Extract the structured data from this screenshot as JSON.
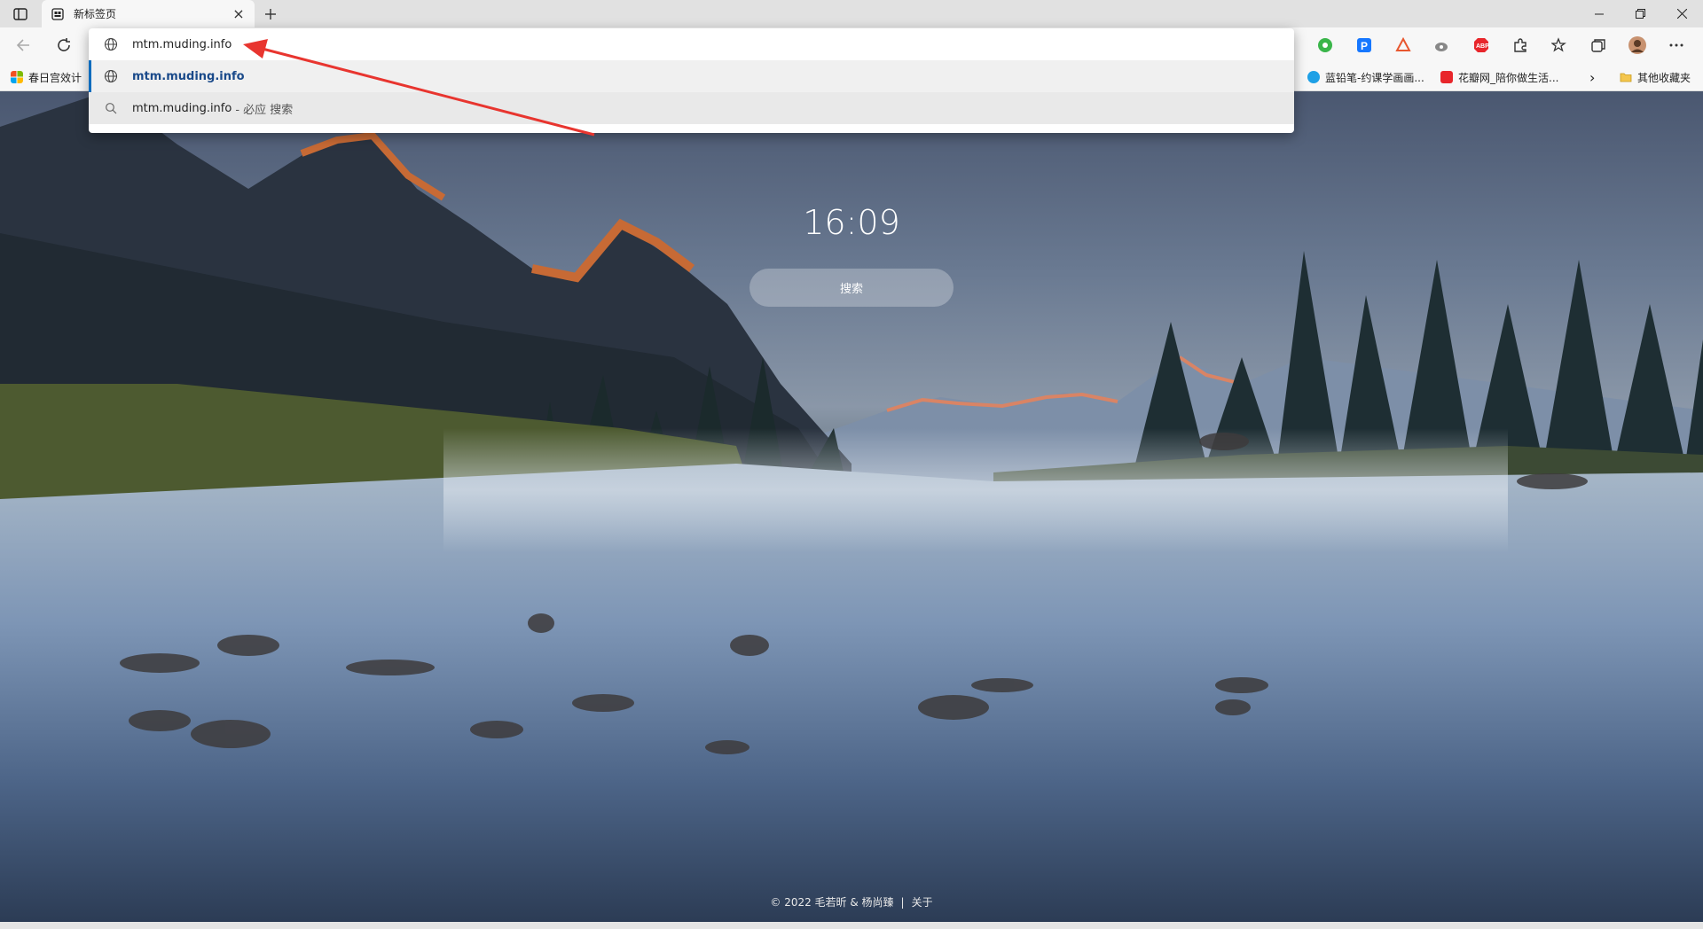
{
  "tab": {
    "title": "新标签页"
  },
  "omnibox": {
    "input_value": "mtm.muding.info",
    "suggestion_url": "mtm.muding.info",
    "suggestion_search_query": "mtm.muding.info",
    "suggestion_search_suffix": "- 必应 搜索"
  },
  "bookmarks": {
    "left_item": "春日宫效计",
    "item1": "蓝铅笔-约课学画画...",
    "item2": "花瓣网_陪你做生活...",
    "more_chevron": "›",
    "other_folder": "其他收藏夹"
  },
  "page": {
    "clock": "16:09",
    "search_label": "搜索",
    "footer_copyright": "© 2022 毛若昕 & 杨尚臻",
    "footer_sep": "|",
    "footer_about": "关于"
  },
  "colors": {
    "accent": "#0f6cbd",
    "arrow": "#e8352f"
  },
  "icons": {
    "tab_actions": "tab-actions-icon",
    "favicon": "newtab-favicon-icon",
    "back": "back-arrow-icon",
    "refresh": "refresh-icon",
    "globe": "globe-icon",
    "search": "search-icon",
    "extensions": [
      "green-wheel-ext-icon",
      "p-ext-icon",
      "orange-ext-icon",
      "weibo-ext-icon",
      "abp-ext-icon",
      "puzzle-icon",
      "favorites-icon",
      "collections-icon",
      "profile-avatar-icon",
      "more-icon"
    ]
  }
}
